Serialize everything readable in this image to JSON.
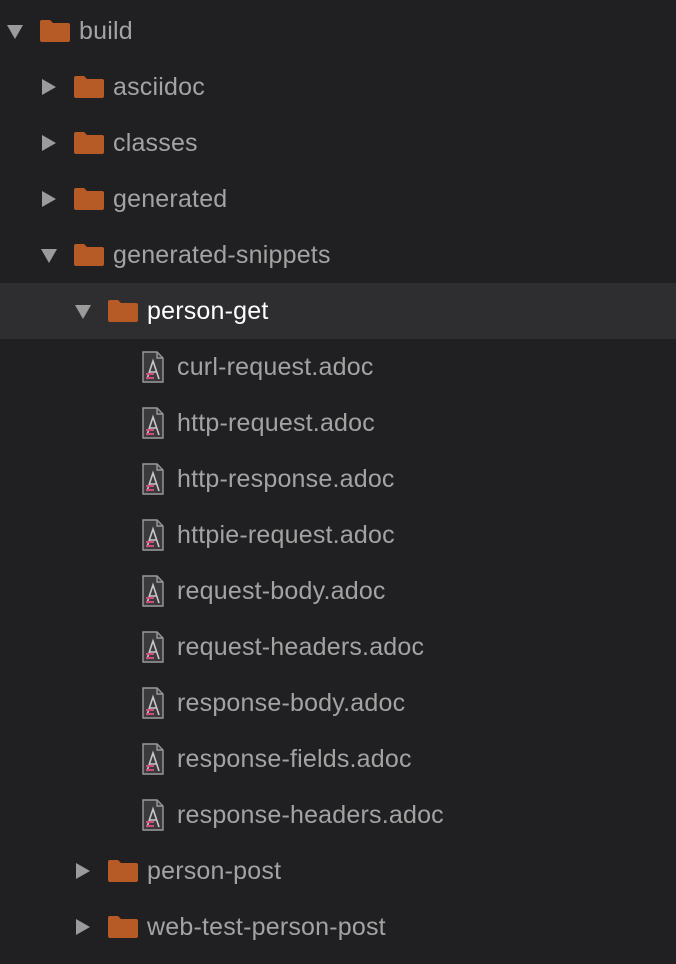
{
  "colors": {
    "background": "#202022",
    "selected_row": "#2e2e30",
    "folder": "#b65a26",
    "text": "#a3a3a3",
    "selected_text": "#ffffff",
    "arrow": "#9b9b9b"
  },
  "tree": [
    {
      "name": "build",
      "kind": "folder",
      "expanded": true,
      "depth": 0,
      "icon": "folder-icon"
    },
    {
      "name": "asciidoc",
      "kind": "folder",
      "expanded": false,
      "depth": 1,
      "icon": "folder-icon"
    },
    {
      "name": "classes",
      "kind": "folder",
      "expanded": false,
      "depth": 1,
      "icon": "folder-icon"
    },
    {
      "name": "generated",
      "kind": "folder",
      "expanded": false,
      "depth": 1,
      "icon": "folder-icon"
    },
    {
      "name": "generated-snippets",
      "kind": "folder",
      "expanded": true,
      "depth": 1,
      "icon": "folder-icon"
    },
    {
      "name": "person-get",
      "kind": "folder",
      "expanded": true,
      "depth": 2,
      "selected": true,
      "icon": "folder-icon"
    },
    {
      "name": "curl-request.adoc",
      "kind": "file",
      "depth": 3,
      "icon": "asciidoc-file-icon"
    },
    {
      "name": "http-request.adoc",
      "kind": "file",
      "depth": 3,
      "icon": "asciidoc-file-icon"
    },
    {
      "name": "http-response.adoc",
      "kind": "file",
      "depth": 3,
      "icon": "asciidoc-file-icon"
    },
    {
      "name": "httpie-request.adoc",
      "kind": "file",
      "depth": 3,
      "icon": "asciidoc-file-icon"
    },
    {
      "name": "request-body.adoc",
      "kind": "file",
      "depth": 3,
      "icon": "asciidoc-file-icon"
    },
    {
      "name": "request-headers.adoc",
      "kind": "file",
      "depth": 3,
      "icon": "asciidoc-file-icon"
    },
    {
      "name": "response-body.adoc",
      "kind": "file",
      "depth": 3,
      "icon": "asciidoc-file-icon"
    },
    {
      "name": "response-fields.adoc",
      "kind": "file",
      "depth": 3,
      "icon": "asciidoc-file-icon"
    },
    {
      "name": "response-headers.adoc",
      "kind": "file",
      "depth": 3,
      "icon": "asciidoc-file-icon"
    },
    {
      "name": "person-post",
      "kind": "folder",
      "expanded": false,
      "depth": 2,
      "icon": "folder-icon"
    },
    {
      "name": "web-test-person-post",
      "kind": "folder",
      "expanded": false,
      "depth": 2,
      "icon": "folder-icon"
    }
  ]
}
